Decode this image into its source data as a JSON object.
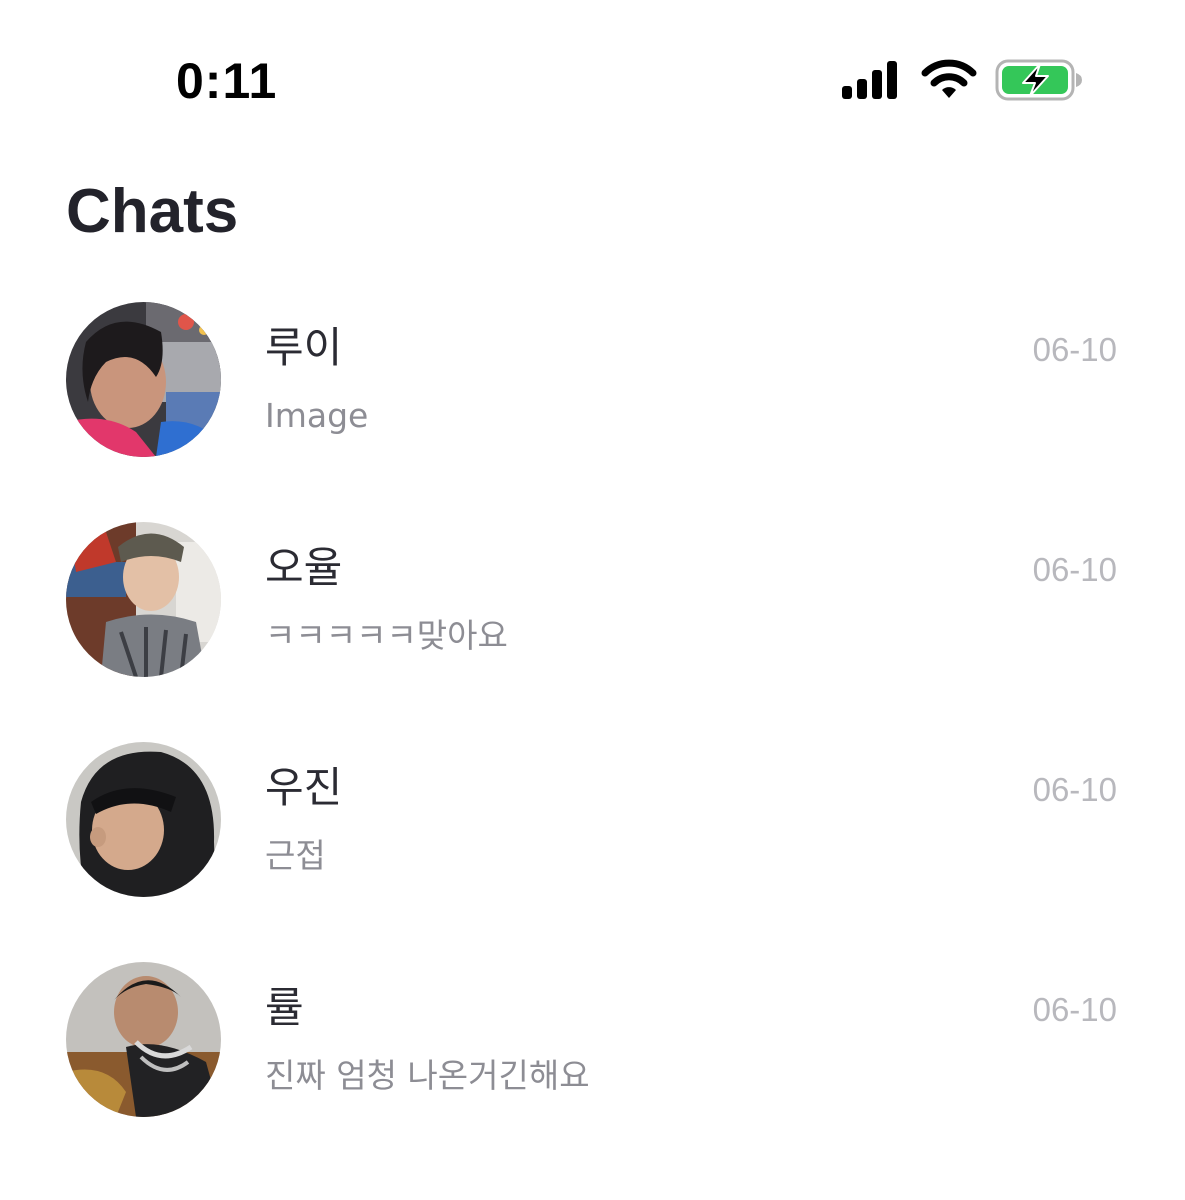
{
  "status_bar": {
    "time": "0:11",
    "signal_icon": "cellular-signal-icon",
    "wifi_icon": "wifi-icon",
    "battery_icon": "battery-charging-icon",
    "battery_color": "#34c759"
  },
  "header": {
    "title": "Chats"
  },
  "chats": [
    {
      "name": "루이",
      "preview": "Image",
      "date": "06-10"
    },
    {
      "name": "오율",
      "preview": "ㅋㅋㅋㅋㅋ맞아요",
      "date": "06-10"
    },
    {
      "name": "우진",
      "preview": "근접",
      "date": "06-10"
    },
    {
      "name": "률",
      "preview": "진짜 엄청 나온거긴해요",
      "date": "06-10"
    }
  ],
  "colors": {
    "title": "#23232b",
    "name": "#2b2b33",
    "preview": "#8d8d94",
    "date": "#b8b8bd"
  }
}
